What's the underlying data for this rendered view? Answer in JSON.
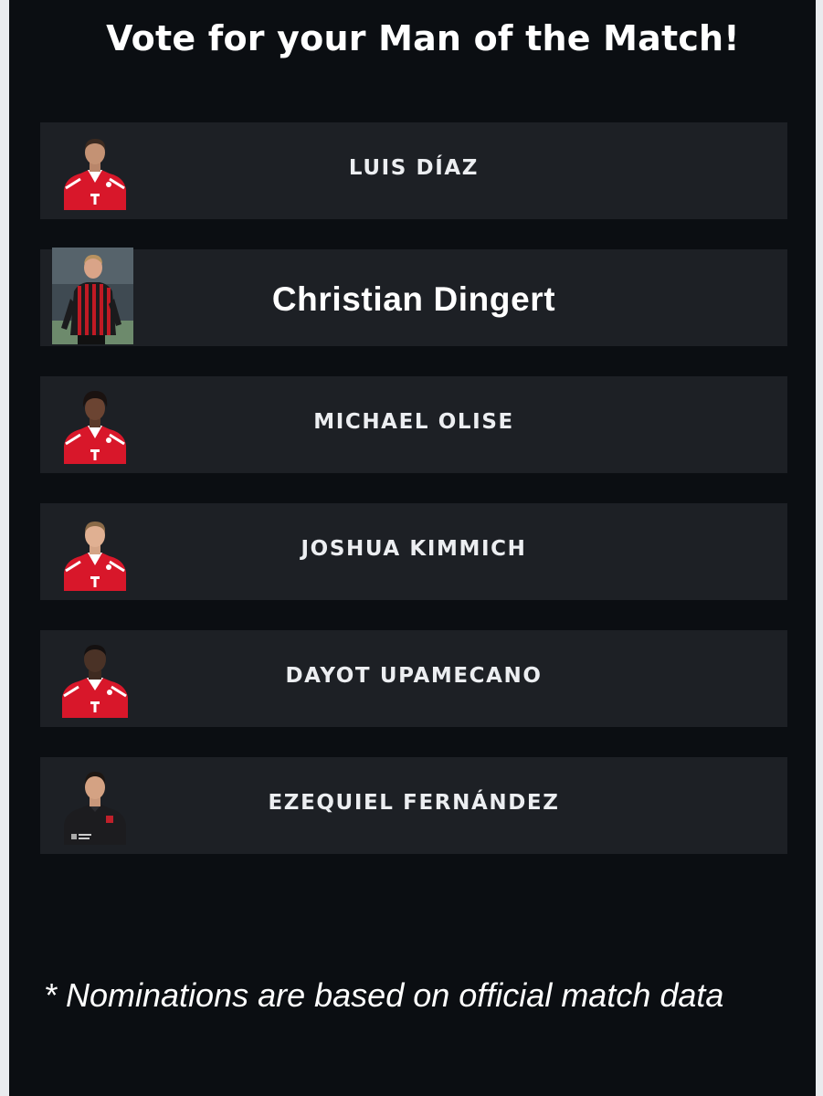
{
  "header": {
    "title": "Vote for your Man of the Match!"
  },
  "nominees": [
    {
      "name": "LUIS DÍAZ",
      "kit": "red"
    },
    {
      "name": "Christian Dingert",
      "kit": "referee"
    },
    {
      "name": "MICHAEL OLISE",
      "kit": "red"
    },
    {
      "name": "JOSHUA KIMMICH",
      "kit": "red"
    },
    {
      "name": "DAYOT UPAMECANO",
      "kit": "red"
    },
    {
      "name": "EZEQUIEL FERNÁNDEZ",
      "kit": "black"
    }
  ],
  "footer": {
    "note": "* Nominations are based on official match data"
  },
  "colors": {
    "background": "#0b0e12",
    "row": "#1d2025",
    "text": "#ffffff",
    "kit_red": "#d8172a"
  }
}
